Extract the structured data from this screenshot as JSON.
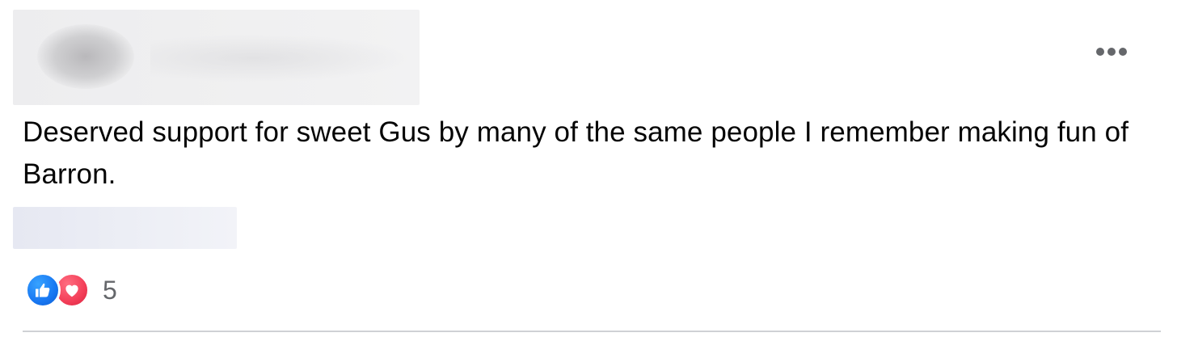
{
  "comment": {
    "text": "Deserved support for sweet Gus by many of the same people I remember making fun of Barron."
  },
  "menu": {
    "icon": "more-options-icon"
  },
  "reactions": {
    "types": [
      "like-icon",
      "love-icon"
    ],
    "count": "5",
    "colors": {
      "like": "#1877f2",
      "love": "#f33e58"
    }
  },
  "colors": {
    "text": "#050505",
    "secondary": "#65676b",
    "divider": "#cfd1d5"
  }
}
